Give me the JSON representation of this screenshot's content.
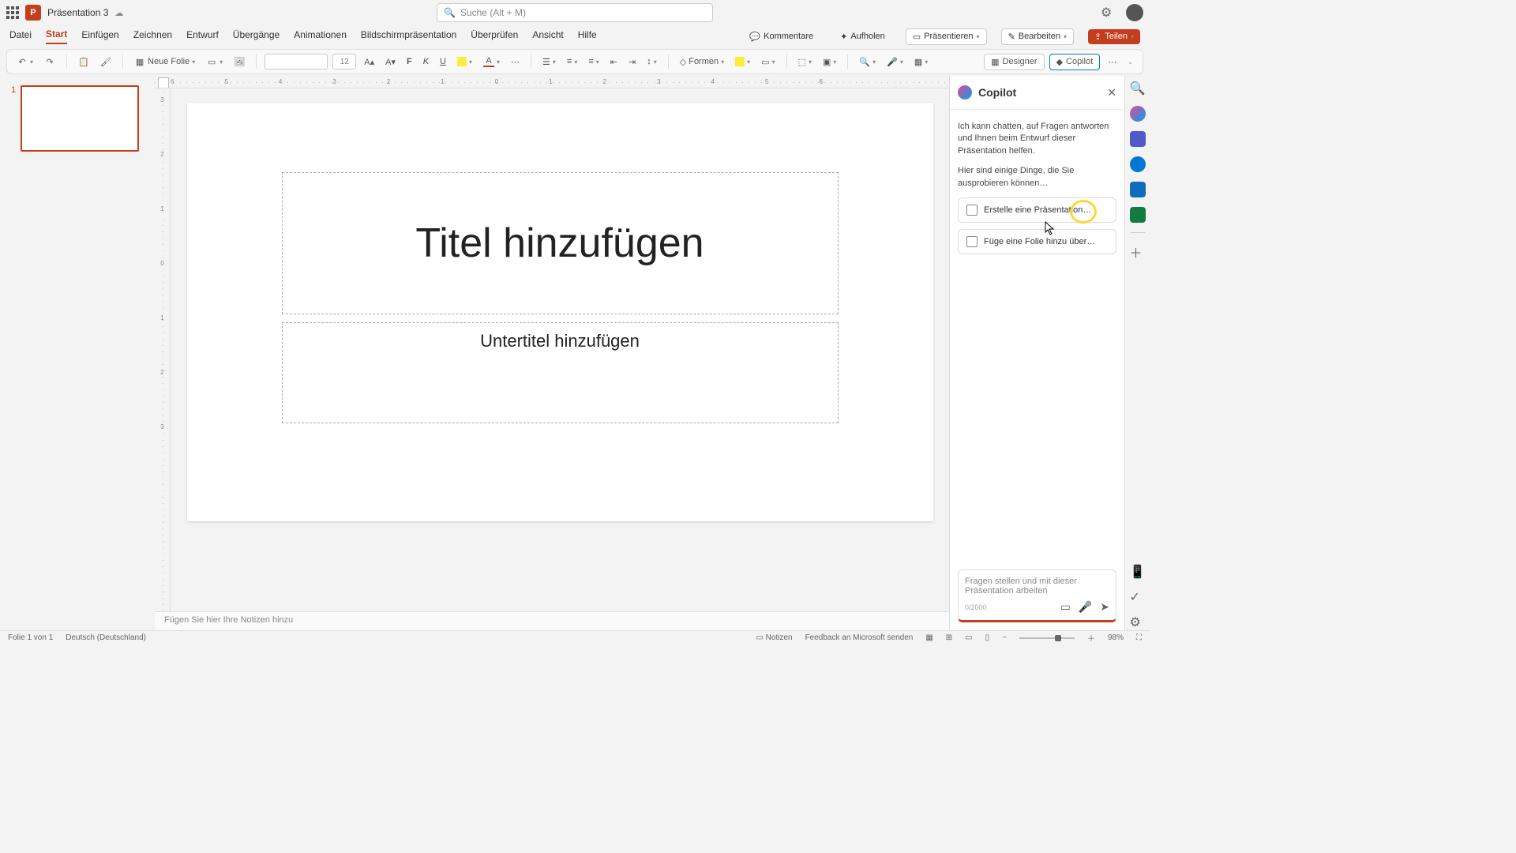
{
  "titlebar": {
    "doc_name": "Präsentation 3",
    "search_placeholder": "Suche (Alt + M)"
  },
  "tabs": {
    "datei": "Datei",
    "start": "Start",
    "einfuegen": "Einfügen",
    "zeichnen": "Zeichnen",
    "entwurf": "Entwurf",
    "uebergaenge": "Übergänge",
    "animationen": "Animationen",
    "bildschirm": "Bildschirmpräsentation",
    "ueberpruefen": "Überprüfen",
    "ansicht": "Ansicht",
    "hilfe": "Hilfe",
    "kommentare": "Kommentare",
    "aufholen": "Aufholen",
    "praesentieren": "Präsentieren",
    "bearbeiten": "Bearbeiten",
    "teilen": "Teilen"
  },
  "toolbar": {
    "neue_folie": "Neue Folie",
    "font_size": "12",
    "formen": "Formen",
    "designer": "Designer",
    "copilot": "Copilot"
  },
  "thumbnails": {
    "slide1_num": "1"
  },
  "ruler_h": [
    "6",
    "5",
    "4",
    "3",
    "2",
    "1",
    "0",
    "1",
    "2",
    "3",
    "4",
    "5",
    "6"
  ],
  "ruler_v": [
    "3",
    "2",
    "1",
    "0",
    "1",
    "2",
    "3"
  ],
  "slide": {
    "title_placeholder": "Titel hinzufügen",
    "subtitle_placeholder": "Untertitel hinzufügen"
  },
  "notes": {
    "placeholder": "Fügen Sie hier Ihre Notizen hinzu"
  },
  "copilot": {
    "title": "Copilot",
    "intro": "Ich kann chatten, auf Fragen antworten und Ihnen beim Entwurf dieser Präsentation helfen.",
    "try": "Hier sind einige Dinge, die Sie ausprobieren können…",
    "sugg1": "Erstelle eine Präsentation…",
    "sugg2": "Füge eine Folie hinzu über…",
    "input_placeholder": "Fragen stellen und mit dieser Präsentation arbeiten",
    "char_count": "0/2000"
  },
  "statusbar": {
    "slide_info": "Folie 1 von 1",
    "language": "Deutsch (Deutschland)",
    "notizen": "Notizen",
    "feedback": "Feedback an Microsoft senden",
    "zoom": "98%"
  }
}
